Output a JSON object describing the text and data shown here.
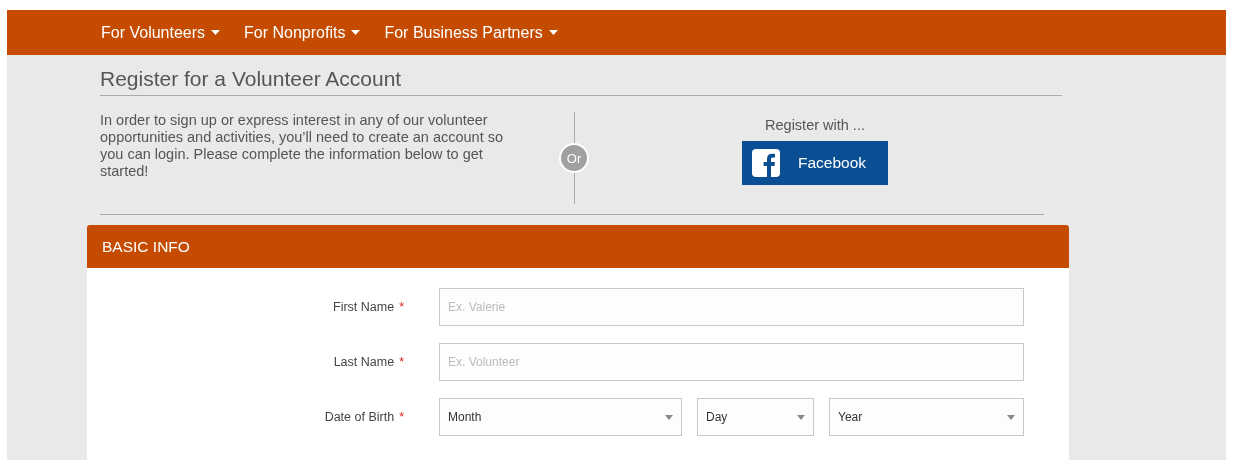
{
  "nav": [
    {
      "label": "For Volunteers"
    },
    {
      "label": "For Nonprofits"
    },
    {
      "label": "For Business Partners"
    }
  ],
  "title": "Register for a Volunteer Account",
  "intro": "In order to sign up or express interest in any of our volunteer opportunities and activities, you’ll need to create an account so you can login. Please complete the information below to get started!",
  "divider_label": "Or",
  "register_with": "Register with ...",
  "social_button": "Facebook",
  "section": {
    "title": "BASIC INFO",
    "fields": [
      {
        "kind": "text",
        "label": "First Name",
        "required_mark": "*",
        "placeholder": "Ex. Valerie"
      },
      {
        "kind": "text",
        "label": "Last Name",
        "required_mark": "*",
        "placeholder": "Ex. Volunteer"
      },
      {
        "kind": "selects",
        "label": "Date of Birth",
        "required_mark": "*",
        "selects": [
          "Month",
          "Day",
          "Year"
        ]
      }
    ]
  }
}
